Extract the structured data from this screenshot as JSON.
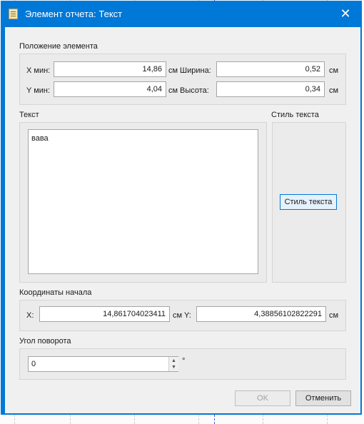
{
  "window": {
    "title": "Элемент отчета: Текст",
    "close_glyph": "✕"
  },
  "position": {
    "group_title": "Положение элемента",
    "xmin_label": "X мин:",
    "xmin_value": "14,86",
    "ymin_label": "Y мин:",
    "ymin_value": "4,04",
    "width_label": "Ширина:",
    "width_value": "0,52",
    "height_label": "Высота:",
    "height_value": "0,34",
    "unit": "см"
  },
  "text": {
    "group_title": "Текст",
    "value": "вава"
  },
  "text_style": {
    "group_title": "Стиль текста",
    "button_label": "Стиль текста"
  },
  "origin": {
    "group_title": "Координаты начала",
    "x_label": "X:",
    "x_value": "14,861704023411",
    "y_label": "Y:",
    "y_value": "4,38856102822291",
    "unit": "см"
  },
  "rotation": {
    "group_title": "Угол поворота",
    "value": "0",
    "unit": "°"
  },
  "buttons": {
    "ok_label": "OK",
    "cancel_label": "Отменить"
  },
  "colors": {
    "titlebar": "#0078d7",
    "dialog_bg": "#f0f0f0"
  }
}
